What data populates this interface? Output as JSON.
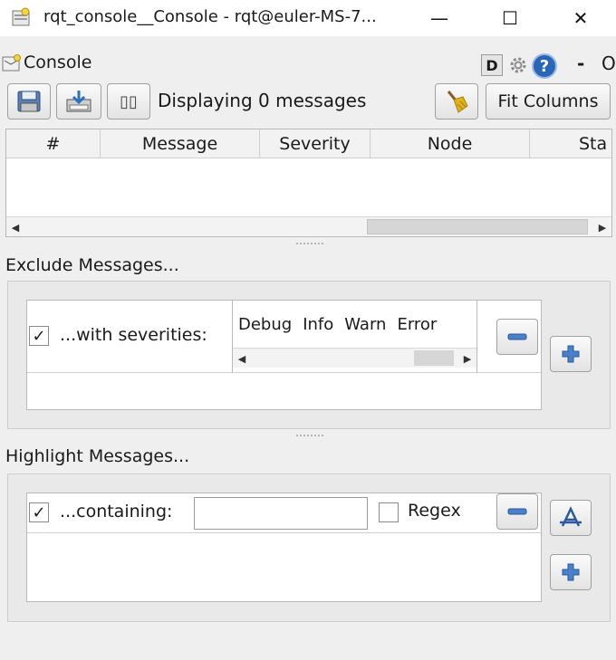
{
  "window": {
    "title": "rqt_console__Console - rqt@euler-MS-7...",
    "min_label": "—",
    "max_label": "☐",
    "close_label": "✕"
  },
  "header": {
    "label": "Console",
    "d_label": "D",
    "help_label": "?",
    "dash_label": "-",
    "o_label": "O"
  },
  "toolbar": {
    "display_count": "Displaying 0 messages",
    "fit_columns_label": "Fit Columns",
    "pause_glyph": "▯▯"
  },
  "messages_table": {
    "columns": [
      "#",
      "Message",
      "Severity",
      "Node",
      "Sta"
    ]
  },
  "exclude": {
    "section_label": "Exclude Messages...",
    "row_label": "...with severities:",
    "checked": true,
    "check_glyph": "✓",
    "severities": [
      "Debug",
      "Info",
      "Warn",
      "Error"
    ]
  },
  "highlight": {
    "section_label": "Highlight Messages...",
    "row_label": "...containing:",
    "checked": true,
    "check_glyph": "✓",
    "input_value": "",
    "regex_label": "Regex",
    "regex_checked": false
  },
  "colors": {
    "accent_blue": "#2a66b8",
    "broom_yellow": "#e2b41c"
  }
}
